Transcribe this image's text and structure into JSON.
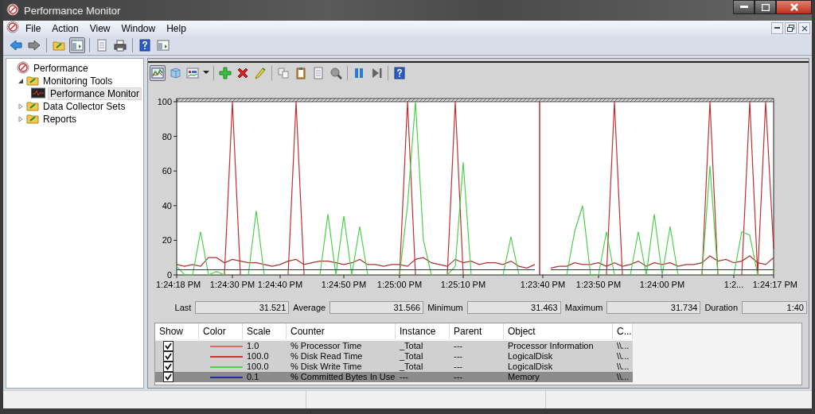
{
  "window": {
    "title": "Performance Monitor"
  },
  "menu": [
    {
      "label": "File"
    },
    {
      "label": "Action"
    },
    {
      "label": "View"
    },
    {
      "label": "Window"
    },
    {
      "label": "Help"
    }
  ],
  "toolbar": [
    {
      "kind": "back",
      "pressed": false
    },
    {
      "kind": "forward",
      "pressed": false
    },
    {
      "kind": "sep"
    },
    {
      "kind": "folder",
      "pressed": false
    },
    {
      "kind": "panel",
      "pressed": true
    },
    {
      "kind": "sep"
    },
    {
      "kind": "document",
      "pressed": false
    },
    {
      "kind": "printer",
      "pressed": false
    },
    {
      "kind": "sep"
    },
    {
      "kind": "help",
      "pressed": false
    },
    {
      "kind": "panel",
      "pressed": false
    }
  ],
  "tree": [
    {
      "label": "Performance",
      "kind": "root",
      "selected": false,
      "children": [
        {
          "label": "Monitoring Tools",
          "kind": "folder",
          "expanded": true,
          "selected": false,
          "children": [
            {
              "label": "Performance Monitor",
              "kind": "monitor",
              "selected": true
            }
          ]
        },
        {
          "label": "Data Collector Sets",
          "kind": "folder",
          "expanded": false,
          "selected": false
        },
        {
          "label": "Reports",
          "kind": "folder",
          "expanded": false,
          "selected": false
        }
      ]
    }
  ],
  "graph_toolbar": [
    {
      "kind": "line-chart",
      "pressed": true
    },
    {
      "kind": "cube",
      "pressed": false
    },
    {
      "kind": "chart",
      "pressed": false
    },
    {
      "kind": "caret"
    },
    {
      "kind": "sep"
    },
    {
      "kind": "plus",
      "pressed": false
    },
    {
      "kind": "cross",
      "pressed": false
    },
    {
      "kind": "pencil",
      "pressed": false
    },
    {
      "kind": "sep"
    },
    {
      "kind": "copy",
      "pressed": false
    },
    {
      "kind": "clipboard",
      "pressed": false
    },
    {
      "kind": "document",
      "pressed": false
    },
    {
      "kind": "magnifier",
      "pressed": false
    },
    {
      "kind": "sep"
    },
    {
      "kind": "pause",
      "pressed": false
    },
    {
      "kind": "skip",
      "pressed": false
    },
    {
      "kind": "sep"
    },
    {
      "kind": "help",
      "pressed": false
    }
  ],
  "chart_data": {
    "type": "line",
    "ylim": [
      0,
      100
    ],
    "yticks": [
      0,
      20,
      40,
      60,
      80,
      100
    ],
    "categories": [
      "1:24:18 PM",
      null,
      null,
      null,
      null,
      null,
      null,
      "1:24:30 PM",
      null,
      null,
      null,
      null,
      null,
      "1:24:40 PM",
      null,
      null,
      null,
      null,
      null,
      null,
      null,
      "1:24:50 PM",
      null,
      null,
      null,
      null,
      null,
      null,
      "1:25:00 PM",
      null,
      null,
      null,
      null,
      null,
      null,
      null,
      "1:25:10 PM",
      null,
      null,
      null,
      null,
      null,
      null,
      null,
      null,
      null,
      "1:23:40 PM",
      null,
      null,
      null,
      null,
      null,
      null,
      "1:23:50 PM",
      null,
      null,
      null,
      null,
      null,
      null,
      null,
      "1:24:00 PM",
      null,
      null,
      null,
      null,
      null,
      null,
      null,
      null,
      "1:2...",
      null,
      null,
      null,
      null,
      "1:24:17 PM"
    ],
    "series": [
      {
        "color": "#a83232",
        "values": [
          6,
          5,
          6,
          5,
          10,
          10,
          7,
          9,
          8,
          7,
          7,
          6,
          5,
          6,
          8,
          9,
          6,
          7,
          8,
          8,
          7,
          6,
          7,
          9,
          6,
          6,
          5,
          6,
          6,
          5,
          9,
          10,
          7,
          6,
          5,
          9,
          7,
          8,
          6,
          7,
          7,
          6,
          8,
          5,
          4,
          6,
          null,
          4,
          5,
          5,
          7,
          6,
          6,
          7,
          5,
          7,
          5,
          6,
          8,
          5,
          7,
          6,
          7,
          5,
          6,
          6,
          7,
          11,
          8,
          9,
          7,
          8,
          11,
          7,
          6,
          10
        ]
      },
      {
        "color": "#c03030",
        "values": [
          null,
          null,
          null,
          null,
          null,
          null,
          0,
          100,
          0,
          null,
          null,
          null,
          null,
          null,
          0,
          100,
          0,
          null,
          null,
          null,
          null,
          null,
          null,
          null,
          null,
          null,
          null,
          null,
          0,
          100,
          0,
          null,
          null,
          null,
          0,
          100,
          0,
          null,
          null,
          null,
          null,
          null,
          null,
          null,
          null,
          null,
          null,
          null,
          null,
          null,
          null,
          null,
          null,
          null,
          0,
          100,
          0,
          null,
          null,
          null,
          null,
          null,
          null,
          null,
          null,
          null,
          0,
          100,
          0,
          null,
          null,
          0,
          100,
          0,
          100,
          15
        ]
      },
      {
        "color": "#4cd04c",
        "values": [
          5,
          0,
          0,
          25,
          0,
          2,
          0,
          null,
          null,
          0,
          37,
          0,
          null,
          null,
          null,
          null,
          null,
          null,
          0,
          35,
          0,
          34,
          0,
          28,
          0,
          null,
          null,
          null,
          0,
          40,
          100,
          20,
          0,
          null,
          0,
          5,
          65,
          0,
          null,
          null,
          null,
          0,
          22,
          0,
          null,
          null,
          null,
          null,
          null,
          0,
          25,
          40,
          0,
          0,
          25,
          0,
          null,
          0,
          25,
          0,
          35,
          0,
          28,
          0,
          null,
          null,
          0,
          63,
          0,
          null,
          0,
          25,
          23,
          0,
          null,
          null
        ]
      },
      {
        "color": "#2a2aa0",
        "values": [
          3,
          3,
          3,
          3,
          3,
          3,
          3,
          3,
          3,
          3,
          3,
          3,
          3,
          3,
          3,
          3,
          3,
          3,
          3,
          3,
          3,
          3,
          3,
          3,
          3,
          3,
          3,
          3,
          3,
          3,
          3,
          3,
          3,
          3,
          3,
          3,
          3,
          3,
          3,
          3,
          3,
          3,
          3,
          3,
          3,
          3,
          null,
          3,
          3,
          3,
          3,
          3,
          3,
          3,
          3,
          3,
          3,
          3,
          3,
          3,
          3,
          3,
          3,
          3,
          3,
          3,
          3,
          3,
          3,
          3,
          3,
          3,
          3,
          3,
          3,
          3
        ]
      }
    ]
  },
  "stats": [
    {
      "label": "Last",
      "value": "31.521"
    },
    {
      "label": "Average",
      "value": "31.566"
    },
    {
      "label": "Minimum",
      "value": "31.463"
    },
    {
      "label": "Maximum",
      "value": "31.734"
    },
    {
      "label": "Duration",
      "value": "1:40"
    }
  ],
  "legend": {
    "columns": [
      "Show",
      "Color",
      "Scale",
      "Counter",
      "Instance",
      "Parent",
      "Object",
      "C..."
    ],
    "rows": [
      {
        "show": true,
        "color": "#e06a6a",
        "scale": "1.0",
        "counter": "% Processor Time",
        "instance": "_Total",
        "parent": "---",
        "object": "Processor Information",
        "column_8": "\\\\...",
        "selected": false
      },
      {
        "show": true,
        "color": "#c83232",
        "scale": "100.0",
        "counter": "% Disk Read Time",
        "instance": "_Total",
        "parent": "---",
        "object": "LogicalDisk",
        "column_8": "\\\\...",
        "selected": false
      },
      {
        "show": true,
        "color": "#4cd04c",
        "scale": "100.0",
        "counter": "% Disk Write Time",
        "instance": "_Total",
        "parent": "---",
        "object": "LogicalDisk",
        "column_8": "\\\\...",
        "selected": false
      },
      {
        "show": true,
        "color": "#2a2aa0",
        "scale": "0.1",
        "counter": "% Committed Bytes In Use",
        "instance": "---",
        "parent": "---",
        "object": "Memory",
        "column_8": "\\\\...",
        "selected": true
      }
    ]
  }
}
